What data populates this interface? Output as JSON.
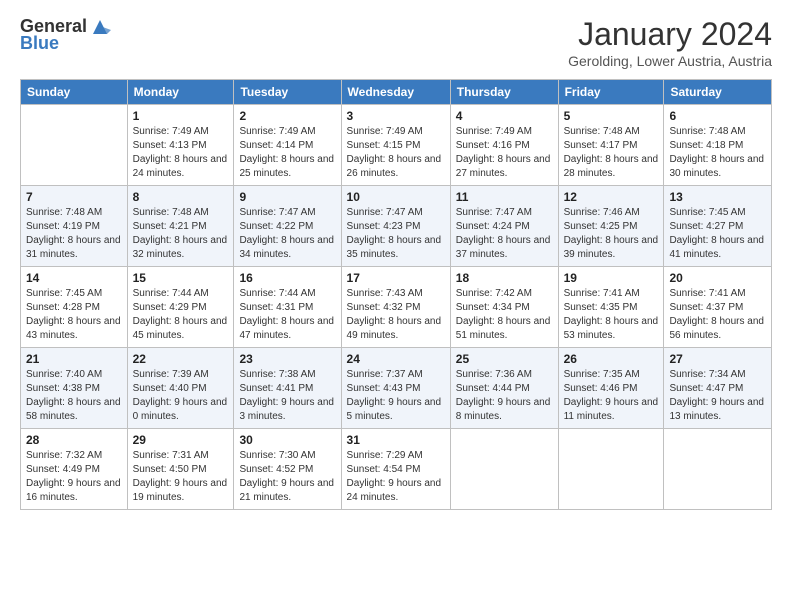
{
  "header": {
    "logo_general": "General",
    "logo_blue": "Blue",
    "title": "January 2024",
    "location": "Gerolding, Lower Austria, Austria"
  },
  "days_of_week": [
    "Sunday",
    "Monday",
    "Tuesday",
    "Wednesday",
    "Thursday",
    "Friday",
    "Saturday"
  ],
  "weeks": [
    {
      "days": [
        {
          "num": "",
          "sunrise": "",
          "sunset": "",
          "daylight": ""
        },
        {
          "num": "1",
          "sunrise": "Sunrise: 7:49 AM",
          "sunset": "Sunset: 4:13 PM",
          "daylight": "Daylight: 8 hours and 24 minutes."
        },
        {
          "num": "2",
          "sunrise": "Sunrise: 7:49 AM",
          "sunset": "Sunset: 4:14 PM",
          "daylight": "Daylight: 8 hours and 25 minutes."
        },
        {
          "num": "3",
          "sunrise": "Sunrise: 7:49 AM",
          "sunset": "Sunset: 4:15 PM",
          "daylight": "Daylight: 8 hours and 26 minutes."
        },
        {
          "num": "4",
          "sunrise": "Sunrise: 7:49 AM",
          "sunset": "Sunset: 4:16 PM",
          "daylight": "Daylight: 8 hours and 27 minutes."
        },
        {
          "num": "5",
          "sunrise": "Sunrise: 7:48 AM",
          "sunset": "Sunset: 4:17 PM",
          "daylight": "Daylight: 8 hours and 28 minutes."
        },
        {
          "num": "6",
          "sunrise": "Sunrise: 7:48 AM",
          "sunset": "Sunset: 4:18 PM",
          "daylight": "Daylight: 8 hours and 30 minutes."
        }
      ]
    },
    {
      "days": [
        {
          "num": "7",
          "sunrise": "Sunrise: 7:48 AM",
          "sunset": "Sunset: 4:19 PM",
          "daylight": "Daylight: 8 hours and 31 minutes."
        },
        {
          "num": "8",
          "sunrise": "Sunrise: 7:48 AM",
          "sunset": "Sunset: 4:21 PM",
          "daylight": "Daylight: 8 hours and 32 minutes."
        },
        {
          "num": "9",
          "sunrise": "Sunrise: 7:47 AM",
          "sunset": "Sunset: 4:22 PM",
          "daylight": "Daylight: 8 hours and 34 minutes."
        },
        {
          "num": "10",
          "sunrise": "Sunrise: 7:47 AM",
          "sunset": "Sunset: 4:23 PM",
          "daylight": "Daylight: 8 hours and 35 minutes."
        },
        {
          "num": "11",
          "sunrise": "Sunrise: 7:47 AM",
          "sunset": "Sunset: 4:24 PM",
          "daylight": "Daylight: 8 hours and 37 minutes."
        },
        {
          "num": "12",
          "sunrise": "Sunrise: 7:46 AM",
          "sunset": "Sunset: 4:25 PM",
          "daylight": "Daylight: 8 hours and 39 minutes."
        },
        {
          "num": "13",
          "sunrise": "Sunrise: 7:45 AM",
          "sunset": "Sunset: 4:27 PM",
          "daylight": "Daylight: 8 hours and 41 minutes."
        }
      ]
    },
    {
      "days": [
        {
          "num": "14",
          "sunrise": "Sunrise: 7:45 AM",
          "sunset": "Sunset: 4:28 PM",
          "daylight": "Daylight: 8 hours and 43 minutes."
        },
        {
          "num": "15",
          "sunrise": "Sunrise: 7:44 AM",
          "sunset": "Sunset: 4:29 PM",
          "daylight": "Daylight: 8 hours and 45 minutes."
        },
        {
          "num": "16",
          "sunrise": "Sunrise: 7:44 AM",
          "sunset": "Sunset: 4:31 PM",
          "daylight": "Daylight: 8 hours and 47 minutes."
        },
        {
          "num": "17",
          "sunrise": "Sunrise: 7:43 AM",
          "sunset": "Sunset: 4:32 PM",
          "daylight": "Daylight: 8 hours and 49 minutes."
        },
        {
          "num": "18",
          "sunrise": "Sunrise: 7:42 AM",
          "sunset": "Sunset: 4:34 PM",
          "daylight": "Daylight: 8 hours and 51 minutes."
        },
        {
          "num": "19",
          "sunrise": "Sunrise: 7:41 AM",
          "sunset": "Sunset: 4:35 PM",
          "daylight": "Daylight: 8 hours and 53 minutes."
        },
        {
          "num": "20",
          "sunrise": "Sunrise: 7:41 AM",
          "sunset": "Sunset: 4:37 PM",
          "daylight": "Daylight: 8 hours and 56 minutes."
        }
      ]
    },
    {
      "days": [
        {
          "num": "21",
          "sunrise": "Sunrise: 7:40 AM",
          "sunset": "Sunset: 4:38 PM",
          "daylight": "Daylight: 8 hours and 58 minutes."
        },
        {
          "num": "22",
          "sunrise": "Sunrise: 7:39 AM",
          "sunset": "Sunset: 4:40 PM",
          "daylight": "Daylight: 9 hours and 0 minutes."
        },
        {
          "num": "23",
          "sunrise": "Sunrise: 7:38 AM",
          "sunset": "Sunset: 4:41 PM",
          "daylight": "Daylight: 9 hours and 3 minutes."
        },
        {
          "num": "24",
          "sunrise": "Sunrise: 7:37 AM",
          "sunset": "Sunset: 4:43 PM",
          "daylight": "Daylight: 9 hours and 5 minutes."
        },
        {
          "num": "25",
          "sunrise": "Sunrise: 7:36 AM",
          "sunset": "Sunset: 4:44 PM",
          "daylight": "Daylight: 9 hours and 8 minutes."
        },
        {
          "num": "26",
          "sunrise": "Sunrise: 7:35 AM",
          "sunset": "Sunset: 4:46 PM",
          "daylight": "Daylight: 9 hours and 11 minutes."
        },
        {
          "num": "27",
          "sunrise": "Sunrise: 7:34 AM",
          "sunset": "Sunset: 4:47 PM",
          "daylight": "Daylight: 9 hours and 13 minutes."
        }
      ]
    },
    {
      "days": [
        {
          "num": "28",
          "sunrise": "Sunrise: 7:32 AM",
          "sunset": "Sunset: 4:49 PM",
          "daylight": "Daylight: 9 hours and 16 minutes."
        },
        {
          "num": "29",
          "sunrise": "Sunrise: 7:31 AM",
          "sunset": "Sunset: 4:50 PM",
          "daylight": "Daylight: 9 hours and 19 minutes."
        },
        {
          "num": "30",
          "sunrise": "Sunrise: 7:30 AM",
          "sunset": "Sunset: 4:52 PM",
          "daylight": "Daylight: 9 hours and 21 minutes."
        },
        {
          "num": "31",
          "sunrise": "Sunrise: 7:29 AM",
          "sunset": "Sunset: 4:54 PM",
          "daylight": "Daylight: 9 hours and 24 minutes."
        },
        {
          "num": "",
          "sunrise": "",
          "sunset": "",
          "daylight": ""
        },
        {
          "num": "",
          "sunrise": "",
          "sunset": "",
          "daylight": ""
        },
        {
          "num": "",
          "sunrise": "",
          "sunset": "",
          "daylight": ""
        }
      ]
    }
  ]
}
